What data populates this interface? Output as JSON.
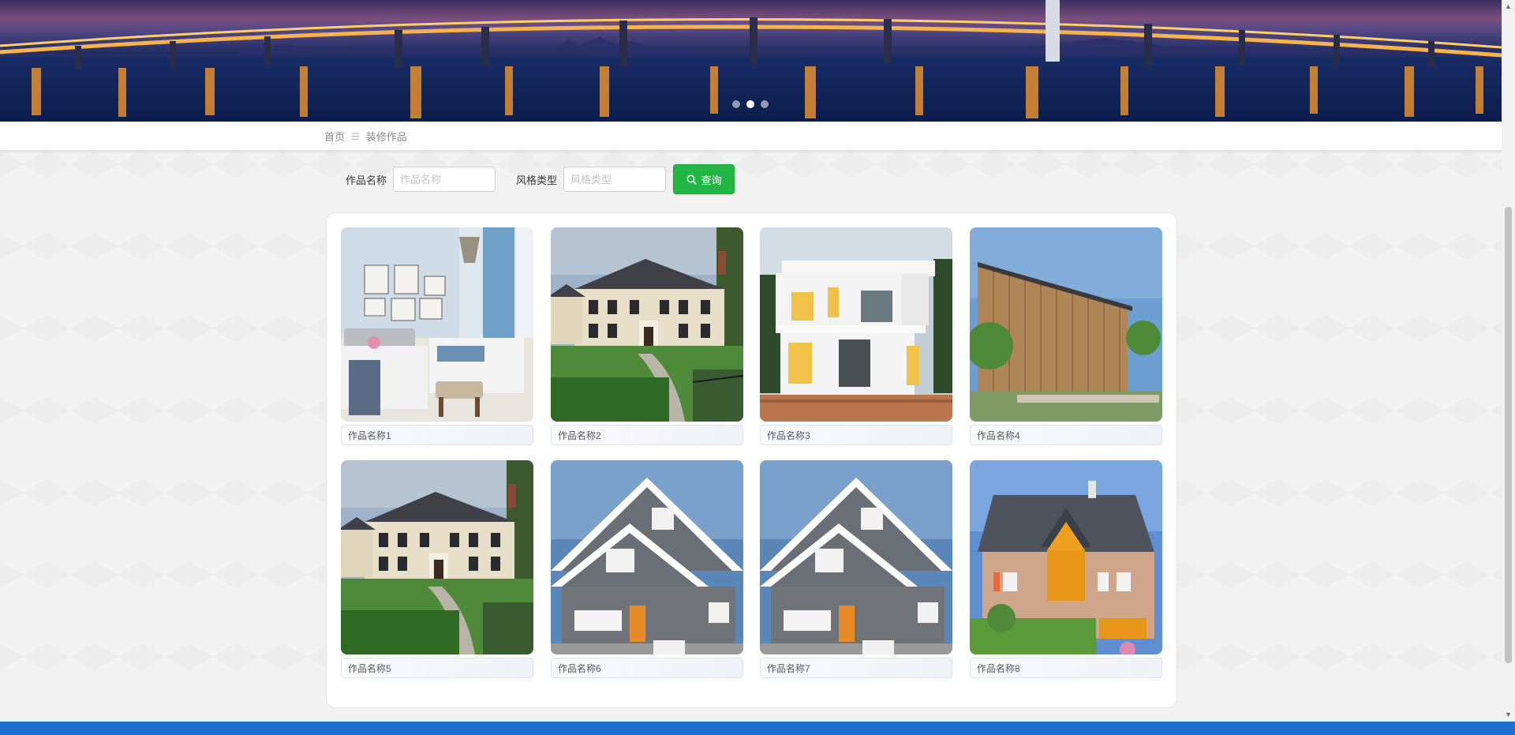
{
  "banner": {
    "image_alt": "bridge-at-night",
    "slides": [
      {
        "active": false
      },
      {
        "active": true
      },
      {
        "active": false
      }
    ]
  },
  "breadcrumb": {
    "home": "首页",
    "separator": "☰",
    "current": "装修作品"
  },
  "search": {
    "name_label": "作品名称",
    "name_placeholder": "作品名称",
    "style_label": "风格类型",
    "style_placeholder": "风格类型",
    "query_label": "查询",
    "query_icon": "search-icon"
  },
  "colors": {
    "accent": "#22b645",
    "footer": "#1e6fd0"
  },
  "works": [
    {
      "title": "作品名称1",
      "image": "bedroom"
    },
    {
      "title": "作品名称2",
      "image": "colonial-house"
    },
    {
      "title": "作品名称3",
      "image": "modern-white-villa"
    },
    {
      "title": "作品名称4",
      "image": "wooden-house"
    },
    {
      "title": "作品名称5",
      "image": "colonial-house"
    },
    {
      "title": "作品名称6",
      "image": "gray-craftsman-house"
    },
    {
      "title": "作品名称7",
      "image": "gray-craftsman-house"
    },
    {
      "title": "作品名称8",
      "image": "brick-house"
    }
  ]
}
